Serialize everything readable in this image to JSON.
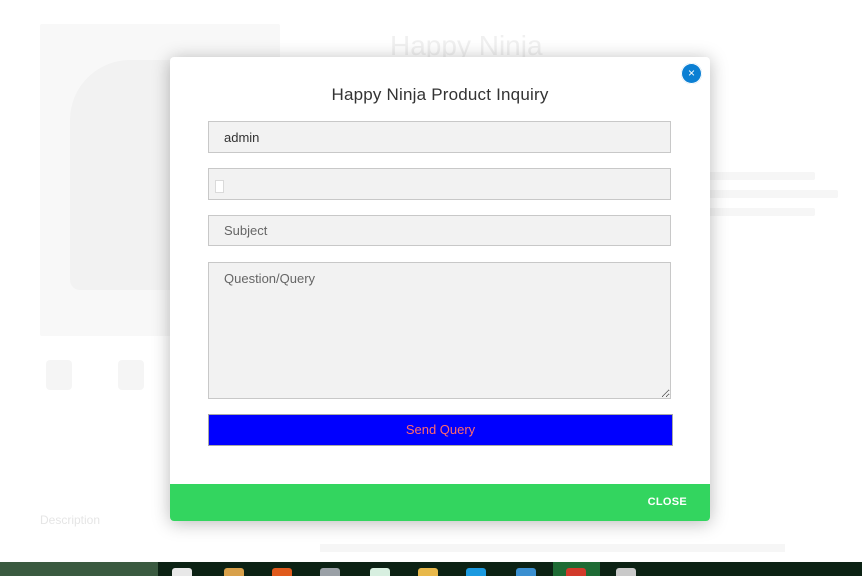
{
  "background": {
    "product_title": "Happy Ninja",
    "stars": "★★★",
    "description_tab": "Description"
  },
  "modal": {
    "title": "Happy Ninja Product Inquiry",
    "close_x": "×",
    "name_value": "admin",
    "email_value": "",
    "subject_placeholder": "Subject",
    "query_placeholder": "Question/Query",
    "send_label": "Send Query",
    "footer_close_label": "CLOSE"
  },
  "colors": {
    "send_button_bg": "#0000ff",
    "send_button_text": "#ff6b6b",
    "footer_bg": "#33d55f",
    "close_x_bg": "#0b7fd3"
  },
  "taskbar": {
    "icons": [
      "file-explorer-icon",
      "pencil-icon",
      "app-icon",
      "calculator-icon",
      "spreadsheet-icon",
      "folder-icon",
      "skype-icon",
      "browser-icon",
      "chrome-icon",
      "media-icon"
    ]
  }
}
